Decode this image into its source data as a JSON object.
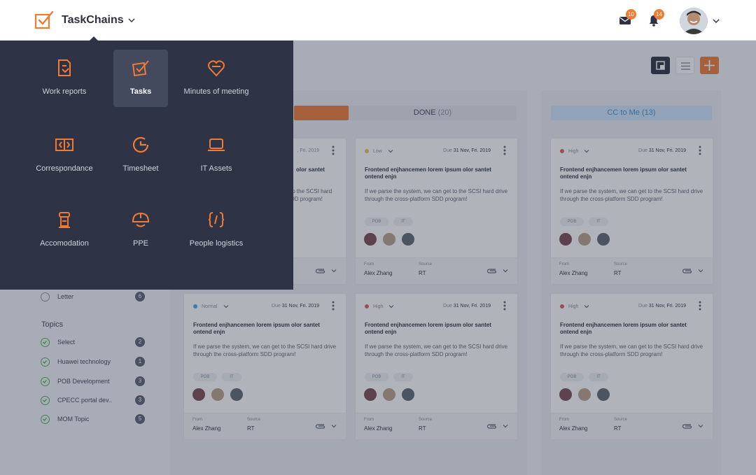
{
  "header": {
    "app_name": "TaskChains",
    "mail_count": "10",
    "notification_count": "14"
  },
  "columns": {
    "done_label": "DONE",
    "done_count": "(20)",
    "cc_label": "CC to Me",
    "cc_count": "(13)"
  },
  "cards": [
    {
      "priority": "Low",
      "due_label": "Due",
      "due": "31 Nov, Fri. 2019",
      "title": "Frontend enjhancemen lorem ipsum olor santet ontend enjn",
      "desc": "If we parse the system, we can get to the SCSI hard drive through the cross-platform SDD program!",
      "tags": [
        "POB",
        "IT"
      ],
      "from_label": "From",
      "from": "Alex Zhang",
      "source_label": "Source",
      "source": "RT"
    },
    {
      "priority": "High",
      "due_label": "Due",
      "due": "31 Nov, Fri. 2019",
      "title": "Frontend enjhancemen lorem ipsum olor santet ontend enjn",
      "desc": "If we parse the system, we can get to the SCSI hard drive through the cross-platform SDD program!",
      "tags": [
        "POB",
        "IT"
      ],
      "from_label": "From",
      "from": "Alex Zhang",
      "source_label": "Source",
      "source": "RT"
    },
    {
      "priority": "Normal",
      "due_label": "Due",
      "due": "31 Nov, Fri. 2019",
      "title": "Frontend enjhancemen lorem ipsum olor santet ontend enjn",
      "desc": "If we parse the system, we can get to the SCSI hard drive through the cross-platform SDD program!",
      "tags": [
        "POB",
        "IT"
      ],
      "from_label": "From",
      "from": "Alex Zhang",
      "source_label": "Source",
      "source": "RT"
    },
    {
      "priority": "High",
      "due_label": "Due",
      "due": "31 Nov, Fri. 2019",
      "title": "Frontend enjhancemen lorem ipsum olor santet ontend enjn",
      "desc": "If we parse the system, we can get to the SCSI hard drive through the cross-platform SDD program!",
      "tags": [
        "POB",
        "IT"
      ],
      "from_label": "From",
      "from": "Alex Zhang",
      "source_label": "Source",
      "source": "RT"
    },
    {
      "priority": "High",
      "due_label": "Due",
      "due": "31 Nov, Fri. 2019",
      "title": "Frontend enjhancemen lorem ipsum olor santet ontend enjn",
      "desc": "If we parse the system, we can get to the SCSI hard drive through the cross-platform SDD program!",
      "tags": [
        "POB",
        "IT"
      ],
      "from_label": "From",
      "from": "Alex Zhang",
      "source_label": "Source",
      "source": "RT"
    }
  ],
  "partial_card": {
    "due_fragment": ", Fri. 2019",
    "title_fragment": "olor santet",
    "desc_fragment_1": "to the SCSI hard",
    "desc_fragment_2": "DD program!"
  },
  "sidebar": {
    "letter": {
      "label": "Letter",
      "count": "6"
    },
    "topics_heading": "Topics",
    "topics": [
      {
        "label": "Select",
        "count": "2"
      },
      {
        "label": "Huawei technology",
        "count": "1"
      },
      {
        "label": "POB Development",
        "count": "3"
      },
      {
        "label": "CPECC portal  dev..",
        "count": "3"
      },
      {
        "label": "MOM Topic",
        "count": "5"
      }
    ]
  },
  "apps_menu": {
    "items": [
      {
        "label": "Work reports",
        "icon": "work-report-icon"
      },
      {
        "label": "Tasks",
        "icon": "tasks-icon",
        "active": true
      },
      {
        "label": "Minutes of meeting",
        "icon": "minutes-icon"
      },
      {
        "label": "Correspondance",
        "icon": "correspondance-icon"
      },
      {
        "label": "Timesheet",
        "icon": "timesheet-icon"
      },
      {
        "label": "IT Assets",
        "icon": "laptop-icon"
      },
      {
        "label": "Accomodation",
        "icon": "accomodation-icon"
      },
      {
        "label": "PPE",
        "icon": "helmet-icon"
      },
      {
        "label": "People logistics",
        "icon": "people-logistics-icon"
      }
    ]
  },
  "colors": {
    "accent": "#ef7b34",
    "menu_bg": "#2e3446",
    "high": "#e05a5a",
    "low": "#e6c84a",
    "normal": "#3fa9e0",
    "cc_tab": "#cfe6fb",
    "cc_text": "#3b8fd9"
  }
}
